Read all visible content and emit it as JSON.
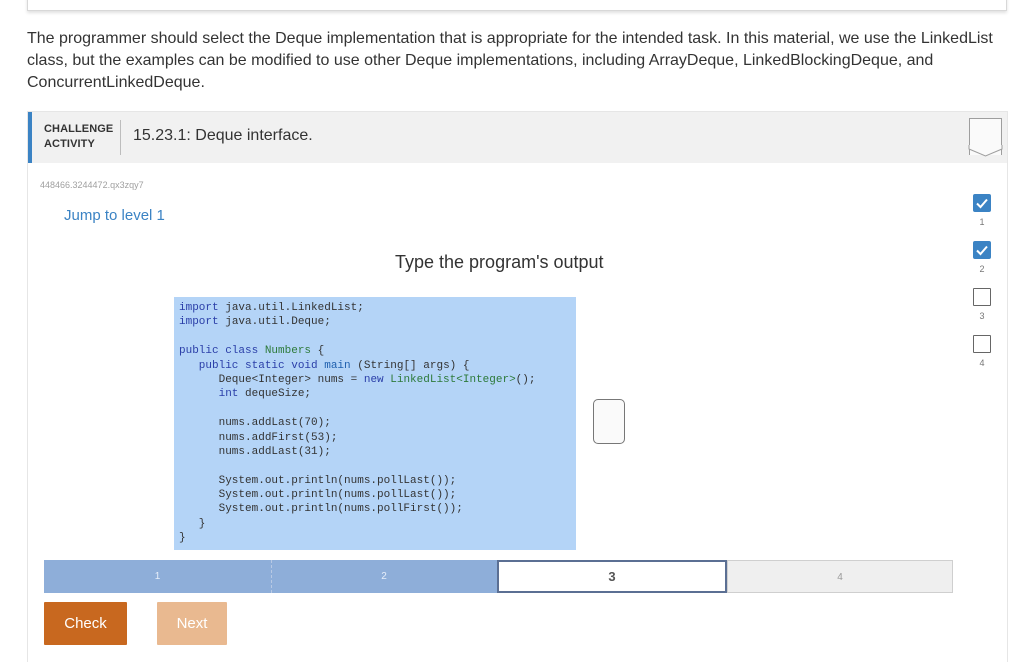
{
  "intro": {
    "text": "The programmer should select the Deque implementation that is appropriate for the intended task. In this material, we use the LinkedList class, but the examples can be modified to use other Deque implementations, including ArrayDeque, LinkedBlockingDeque, and ConcurrentLinkedDeque."
  },
  "activity": {
    "label_line1": "CHALLENGE",
    "label_line2": "ACTIVITY",
    "title": "15.23.1: Deque interface.",
    "id": "448466.3244472.qx3zqy7",
    "jump_link": "Jump to level 1",
    "prompt": "Type the program's output"
  },
  "code": {
    "lines": [
      [
        {
          "t": "import ",
          "c": "kw"
        },
        {
          "t": "java.util.LinkedList;",
          "c": ""
        }
      ],
      [
        {
          "t": "import ",
          "c": "kw"
        },
        {
          "t": "java.util.Deque;",
          "c": ""
        }
      ],
      [],
      [
        {
          "t": "public class ",
          "c": "kw"
        },
        {
          "t": "Numbers ",
          "c": "cls"
        },
        {
          "t": "{",
          "c": ""
        }
      ],
      [
        {
          "t": "   public static void ",
          "c": "kw"
        },
        {
          "t": "main ",
          "c": "fn"
        },
        {
          "t": "(String[] args) {",
          "c": ""
        }
      ],
      [
        {
          "t": "      Deque<Integer> nums = ",
          "c": ""
        },
        {
          "t": "new ",
          "c": "kw"
        },
        {
          "t": "LinkedList<Integer>",
          "c": "cls"
        },
        {
          "t": "();",
          "c": ""
        }
      ],
      [
        {
          "t": "      int ",
          "c": "ty"
        },
        {
          "t": "dequeSize;",
          "c": ""
        }
      ],
      [],
      [
        {
          "t": "      nums.addLast(70);",
          "c": ""
        }
      ],
      [
        {
          "t": "      nums.addFirst(53);",
          "c": ""
        }
      ],
      [
        {
          "t": "      nums.addLast(31);",
          "c": ""
        }
      ],
      [],
      [
        {
          "t": "      System.out.println(nums.pollLast());",
          "c": ""
        }
      ],
      [
        {
          "t": "      System.out.println(nums.pollLast());",
          "c": ""
        }
      ],
      [
        {
          "t": "      System.out.println(nums.pollFirst());",
          "c": ""
        }
      ],
      [
        {
          "t": "   }",
          "c": ""
        }
      ],
      [
        {
          "t": "}",
          "c": ""
        }
      ]
    ]
  },
  "answer": {
    "value": ""
  },
  "levels": [
    {
      "number": "1",
      "completed": true
    },
    {
      "number": "2",
      "completed": true
    },
    {
      "number": "3",
      "completed": false
    },
    {
      "number": "4",
      "completed": false
    }
  ],
  "progress": {
    "segments": [
      {
        "label": "1",
        "state": "done"
      },
      {
        "label": "2",
        "state": "done"
      },
      {
        "label": "3",
        "state": "current"
      },
      {
        "label": "4",
        "state": "todo"
      }
    ]
  },
  "buttons": {
    "check": "Check",
    "next": "Next"
  },
  "colors": {
    "accent": "#3b83c4",
    "check_button": "#c8681f",
    "next_button": "#e9b990",
    "code_background": "#b4d4f7"
  }
}
